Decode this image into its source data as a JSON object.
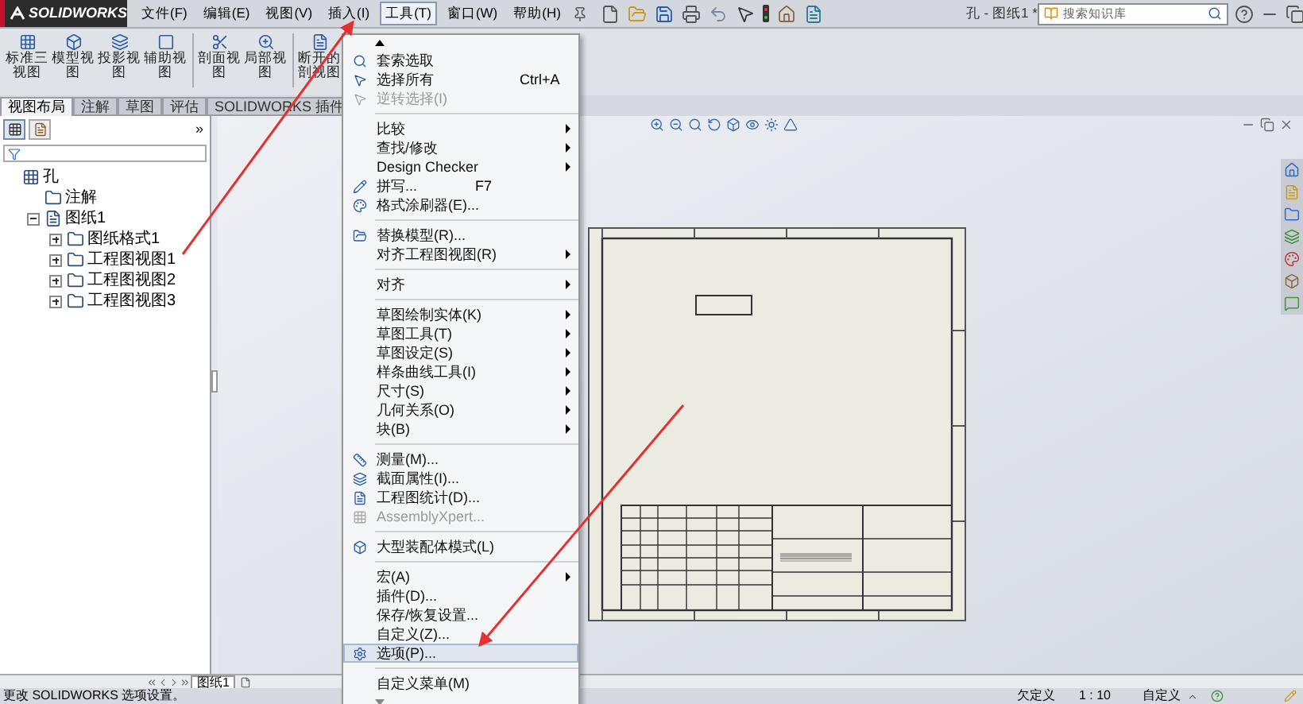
{
  "app_logo": "SOLIDWORKS",
  "menubar": [
    {
      "label": "文件(F)",
      "selected": false
    },
    {
      "label": "编辑(E)",
      "selected": false
    },
    {
      "label": "视图(V)",
      "selected": false
    },
    {
      "label": "插入(I)",
      "selected": false
    },
    {
      "label": "工具(T)",
      "selected": true
    },
    {
      "label": "窗口(W)",
      "selected": false
    },
    {
      "label": "帮助(H)",
      "selected": false
    }
  ],
  "window": {
    "title": "孔 - 图纸1 *"
  },
  "search": {
    "placeholder": "搜索知识库"
  },
  "command_manager": [
    {
      "label": "标准三视图"
    },
    {
      "label": "模型视图"
    },
    {
      "label": "投影视图"
    },
    {
      "label": "辅助视图"
    },
    {
      "label": "剖面视图"
    },
    {
      "label": "局部视图"
    },
    {
      "label": "断开的剖视图"
    }
  ],
  "tabs": [
    {
      "label": "视图布局",
      "selected": true
    },
    {
      "label": "注解",
      "selected": false
    },
    {
      "label": "草图",
      "selected": false
    },
    {
      "label": "评估",
      "selected": false
    },
    {
      "label": "SOLIDWORKS 插件",
      "selected": false
    }
  ],
  "panel": {
    "collapse_glyph": "»"
  },
  "tree": [
    {
      "label": "孔",
      "children": [
        {
          "label": "注解"
        },
        {
          "label": "图纸1",
          "expanded": true,
          "children": [
            {
              "label": "图纸格式1",
              "expanded": false
            },
            {
              "label": "工程图视图1",
              "expanded": false
            },
            {
              "label": "工程图视图2",
              "expanded": false
            },
            {
              "label": "工程图视图3",
              "expanded": false
            }
          ]
        }
      ]
    }
  ],
  "tools_menu": [
    {
      "kind": "item",
      "label": "套索选取",
      "disabled": false,
      "submenu": false,
      "selected": false
    },
    {
      "kind": "item",
      "label": "选择所有",
      "shortcut": "Ctrl+A",
      "disabled": false,
      "submenu": false,
      "selected": false
    },
    {
      "kind": "item",
      "label": "逆转选择(I)",
      "disabled": true,
      "submenu": false,
      "selected": false
    },
    {
      "kind": "separator"
    },
    {
      "kind": "item",
      "label": "比较",
      "disabled": false,
      "submenu": true,
      "selected": false
    },
    {
      "kind": "item",
      "label": "查找/修改",
      "disabled": false,
      "submenu": true,
      "selected": false
    },
    {
      "kind": "item",
      "label": "Design Checker",
      "disabled": false,
      "submenu": true,
      "selected": false
    },
    {
      "kind": "item",
      "label": "拼写...",
      "shortcut": "F7",
      "disabled": false,
      "submenu": false,
      "selected": false
    },
    {
      "kind": "item",
      "label": "格式涂刷器(E)...",
      "disabled": false,
      "submenu": false,
      "selected": false
    },
    {
      "kind": "separator"
    },
    {
      "kind": "item",
      "label": "替换模型(R)...",
      "disabled": false,
      "submenu": false,
      "selected": false
    },
    {
      "kind": "item",
      "label": "对齐工程图视图(R)",
      "disabled": false,
      "submenu": true,
      "selected": false
    },
    {
      "kind": "separator"
    },
    {
      "kind": "item",
      "label": "对齐",
      "disabled": false,
      "submenu": true,
      "selected": false
    },
    {
      "kind": "separator"
    },
    {
      "kind": "item",
      "label": "草图绘制实体(K)",
      "disabled": false,
      "submenu": true,
      "selected": false
    },
    {
      "kind": "item",
      "label": "草图工具(T)",
      "disabled": false,
      "submenu": true,
      "selected": false
    },
    {
      "kind": "item",
      "label": "草图设定(S)",
      "disabled": false,
      "submenu": true,
      "selected": false
    },
    {
      "kind": "item",
      "label": "样条曲线工具(I)",
      "disabled": false,
      "submenu": true,
      "selected": false
    },
    {
      "kind": "item",
      "label": "尺寸(S)",
      "disabled": false,
      "submenu": true,
      "selected": false
    },
    {
      "kind": "item",
      "label": "几何关系(O)",
      "disabled": false,
      "submenu": true,
      "selected": false
    },
    {
      "kind": "item",
      "label": "块(B)",
      "disabled": false,
      "submenu": true,
      "selected": false
    },
    {
      "kind": "separator"
    },
    {
      "kind": "item",
      "label": "测量(M)...",
      "disabled": false,
      "submenu": false,
      "selected": false
    },
    {
      "kind": "item",
      "label": "截面属性(I)...",
      "disabled": false,
      "submenu": false,
      "selected": false
    },
    {
      "kind": "item",
      "label": "工程图统计(D)...",
      "disabled": false,
      "submenu": false,
      "selected": false
    },
    {
      "kind": "item",
      "label": "AssemblyXpert...",
      "disabled": true,
      "submenu": false,
      "selected": false
    },
    {
      "kind": "separator"
    },
    {
      "kind": "item",
      "label": "大型装配体模式(L)",
      "disabled": false,
      "submenu": false,
      "selected": false
    },
    {
      "kind": "separator"
    },
    {
      "kind": "item",
      "label": "宏(A)",
      "disabled": false,
      "submenu": true,
      "selected": false
    },
    {
      "kind": "item",
      "label": "插件(D)...",
      "disabled": false,
      "submenu": false,
      "selected": false
    },
    {
      "kind": "item",
      "label": "保存/恢复设置...",
      "disabled": false,
      "submenu": false,
      "selected": false
    },
    {
      "kind": "item",
      "label": "自定义(Z)...",
      "disabled": false,
      "submenu": false,
      "selected": false
    },
    {
      "kind": "item",
      "label": "选项(P)...",
      "disabled": false,
      "submenu": false,
      "selected": true
    },
    {
      "kind": "separator"
    },
    {
      "kind": "item",
      "label": "自定义菜单(M)",
      "disabled": false,
      "submenu": false,
      "selected": false
    }
  ],
  "sheet_tabs": [
    {
      "label": "图纸1",
      "selected": true
    }
  ],
  "status_bar": {
    "message": "更改 SOLIDWORKS 选项设置。",
    "state": "欠定义",
    "scale": "1 : 10",
    "units": "自定义"
  }
}
